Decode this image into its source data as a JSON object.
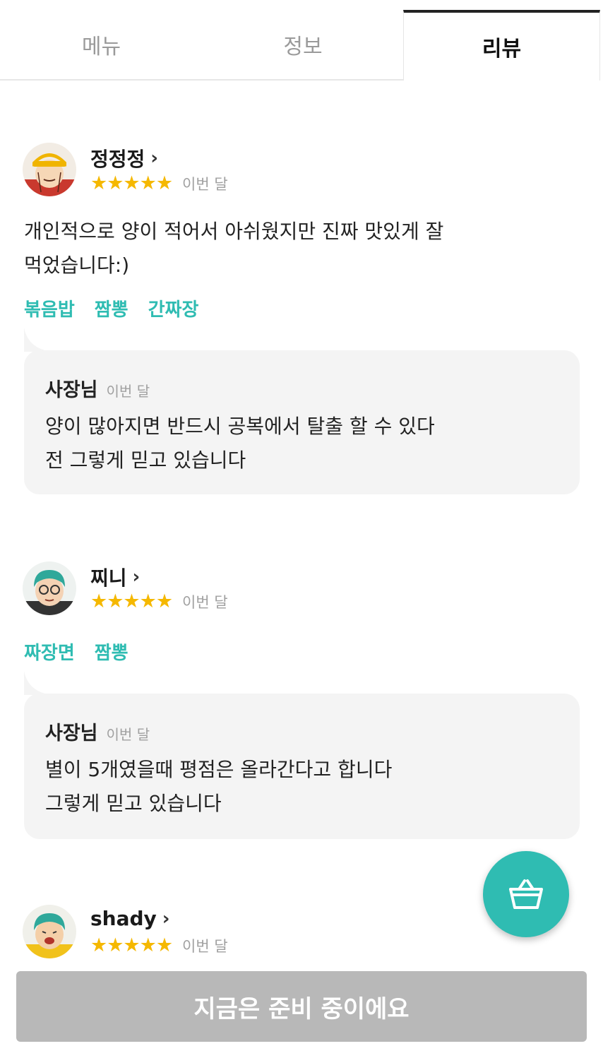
{
  "tabs": [
    {
      "label": "메뉴",
      "active": false
    },
    {
      "label": "정보",
      "active": false
    },
    {
      "label": "리뷰",
      "active": true
    }
  ],
  "reviews": [
    {
      "user": "정정정",
      "stars": "★★★★★",
      "rating": 5,
      "date": "이번 달",
      "text_lines": [
        "개인적으로 양이 적어서 아쉬웠지만 진짜 맛있게 잘",
        "먹었습니다:)"
      ],
      "tags": [
        "볶음밥",
        "짬뽕",
        "간짜장"
      ],
      "reply": {
        "author": "사장님",
        "date": "이번 달",
        "lines": [
          "양이 많아지면 반드시 공복에서 탈출 할 수 있다",
          "전 그렇게 믿고 있습니다"
        ]
      }
    },
    {
      "user": "찌니",
      "stars": "★★★★★",
      "rating": 5,
      "date": "이번 달",
      "tags": [
        "짜장면",
        "짬뽕"
      ],
      "reply": {
        "author": "사장님",
        "date": "이번 달",
        "lines": [
          "별이 5개였을때 평점은 올라간다고 합니다",
          "그렇게 믿고 있습니다"
        ]
      }
    },
    {
      "user": "shady",
      "stars": "★★★★★",
      "rating": 5,
      "date": "이번 달"
    }
  ],
  "chevron": "›",
  "fab_icon": "basket-icon",
  "bottom_button": "지금은 준비 중이에요",
  "colors": {
    "accent": "#2fbcb2",
    "star": "#f5b800",
    "disabled": "#b8b8b8"
  }
}
